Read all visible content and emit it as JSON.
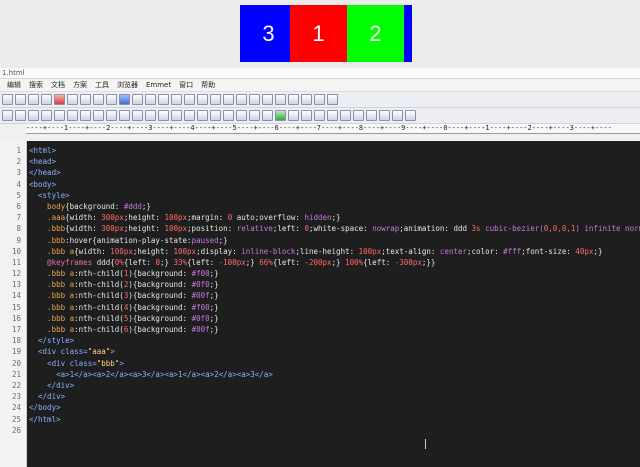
{
  "preview": {
    "slides": [
      "3",
      "1",
      "2"
    ],
    "colors": {
      "background": "#0000ff",
      "slide_red": "#ff0000",
      "slide_green": "#00ff00"
    }
  },
  "window": {
    "title": "1.html"
  },
  "menu": [
    "编辑",
    "搜索",
    "文档",
    "方案",
    "工具",
    "浏览器",
    "Emmet",
    "窗口",
    "帮助"
  ],
  "ruler": "----+----1----+----2----+----3----+----4----+----5----+----6----+----7----+----8----+----9----+----0----+----1----+----2----+----3----+----",
  "code_lines": [
    {
      "n": "1",
      "segs": [
        {
          "t": "<html>",
          "c": "tag"
        }
      ]
    },
    {
      "n": "2",
      "segs": [
        {
          "t": "<head>",
          "c": "tag"
        }
      ]
    },
    {
      "n": "3",
      "segs": [
        {
          "t": "</head>",
          "c": "tag"
        }
      ]
    },
    {
      "n": "4",
      "segs": [
        {
          "t": "<body>",
          "c": "tag"
        }
      ]
    },
    {
      "n": "5",
      "segs": [
        {
          "t": "  <style>",
          "c": "tag"
        }
      ]
    },
    {
      "n": "6",
      "segs": [
        {
          "t": "    body",
          "c": "sel"
        },
        {
          "t": "{background: ",
          "c": "prop"
        },
        {
          "t": "#ddd",
          "c": "val"
        },
        {
          "t": ";}",
          "c": "prop"
        }
      ]
    },
    {
      "n": "7",
      "segs": [
        {
          "t": "    .aaa",
          "c": "sel"
        },
        {
          "t": "{width: ",
          "c": "prop"
        },
        {
          "t": "300px",
          "c": "num"
        },
        {
          "t": ";height: ",
          "c": "prop"
        },
        {
          "t": "100px",
          "c": "num"
        },
        {
          "t": ";margin: ",
          "c": "prop"
        },
        {
          "t": "0",
          "c": "num"
        },
        {
          "t": " auto;overflow: ",
          "c": "prop"
        },
        {
          "t": "hidden",
          "c": "val"
        },
        {
          "t": ";}",
          "c": "prop"
        }
      ]
    },
    {
      "n": "8",
      "segs": [
        {
          "t": "    .bbb",
          "c": "sel"
        },
        {
          "t": "{width: ",
          "c": "prop"
        },
        {
          "t": "300px",
          "c": "num"
        },
        {
          "t": ";height: ",
          "c": "prop"
        },
        {
          "t": "100px",
          "c": "num"
        },
        {
          "t": ";position: ",
          "c": "prop"
        },
        {
          "t": "relative",
          "c": "val"
        },
        {
          "t": ";left: ",
          "c": "prop"
        },
        {
          "t": "0",
          "c": "num"
        },
        {
          "t": ";white-space: ",
          "c": "prop"
        },
        {
          "t": "nowrap",
          "c": "val"
        },
        {
          "t": ";animation: ddd ",
          "c": "prop"
        },
        {
          "t": "3s",
          "c": "num"
        },
        {
          "t": " cubic-bezier(",
          "c": "val"
        },
        {
          "t": "0,0,0,1",
          "c": "num"
        },
        {
          "t": ") infinite normal;}",
          "c": "val"
        }
      ]
    },
    {
      "n": "9",
      "segs": [
        {
          "t": "    .bbb",
          "c": "sel"
        },
        {
          "t": ":hover{animation-play-state:",
          "c": "prop"
        },
        {
          "t": "paused",
          "c": "val"
        },
        {
          "t": ";}",
          "c": "prop"
        }
      ]
    },
    {
      "n": "10",
      "segs": [
        {
          "t": "    .bbb a",
          "c": "sel"
        },
        {
          "t": "{width: ",
          "c": "prop"
        },
        {
          "t": "100px",
          "c": "num"
        },
        {
          "t": ";height: ",
          "c": "prop"
        },
        {
          "t": "100px",
          "c": "num"
        },
        {
          "t": ";display: ",
          "c": "prop"
        },
        {
          "t": "inline-block",
          "c": "val"
        },
        {
          "t": ";line-height: ",
          "c": "prop"
        },
        {
          "t": "100px",
          "c": "num"
        },
        {
          "t": ";text-align: ",
          "c": "prop"
        },
        {
          "t": "center",
          "c": "val"
        },
        {
          "t": ";color: ",
          "c": "prop"
        },
        {
          "t": "#fff",
          "c": "val"
        },
        {
          "t": ";font-size: ",
          "c": "prop"
        },
        {
          "t": "40px",
          "c": "num"
        },
        {
          "t": ";}",
          "c": "prop"
        }
      ]
    },
    {
      "n": "11",
      "segs": [
        {
          "t": "    @keyframes",
          "c": "kw"
        },
        {
          "t": " ddd{",
          "c": "prop"
        },
        {
          "t": "0%",
          "c": "num"
        },
        {
          "t": "{left: ",
          "c": "prop"
        },
        {
          "t": "0",
          "c": "num"
        },
        {
          "t": ";} ",
          "c": "prop"
        },
        {
          "t": "33%",
          "c": "num"
        },
        {
          "t": "{left: ",
          "c": "prop"
        },
        {
          "t": "-100px",
          "c": "num"
        },
        {
          "t": ";} ",
          "c": "prop"
        },
        {
          "t": "66%",
          "c": "num"
        },
        {
          "t": "{left: ",
          "c": "prop"
        },
        {
          "t": "-200px",
          "c": "num"
        },
        {
          "t": ";} ",
          "c": "prop"
        },
        {
          "t": "100%",
          "c": "num"
        },
        {
          "t": "{left: ",
          "c": "prop"
        },
        {
          "t": "-300px",
          "c": "num"
        },
        {
          "t": ";}}",
          "c": "prop"
        }
      ]
    },
    {
      "n": "12",
      "segs": [
        {
          "t": "    .bbb a",
          "c": "sel"
        },
        {
          "t": ":nth-child(",
          "c": "prop"
        },
        {
          "t": "1",
          "c": "num"
        },
        {
          "t": "){background: ",
          "c": "prop"
        },
        {
          "t": "#f00",
          "c": "val"
        },
        {
          "t": ";}",
          "c": "prop"
        }
      ]
    },
    {
      "n": "13",
      "segs": [
        {
          "t": "    .bbb a",
          "c": "sel"
        },
        {
          "t": ":nth-child(",
          "c": "prop"
        },
        {
          "t": "2",
          "c": "num"
        },
        {
          "t": "){background: ",
          "c": "prop"
        },
        {
          "t": "#0f0",
          "c": "val"
        },
        {
          "t": ";}",
          "c": "prop"
        }
      ]
    },
    {
      "n": "14",
      "segs": [
        {
          "t": "    .bbb a",
          "c": "sel"
        },
        {
          "t": ":nth-child(",
          "c": "prop"
        },
        {
          "t": "3",
          "c": "num"
        },
        {
          "t": "){background: ",
          "c": "prop"
        },
        {
          "t": "#00f",
          "c": "val"
        },
        {
          "t": ";}",
          "c": "prop"
        }
      ]
    },
    {
      "n": "15",
      "segs": [
        {
          "t": "    .bbb a",
          "c": "sel"
        },
        {
          "t": ":nth-child(",
          "c": "prop"
        },
        {
          "t": "4",
          "c": "num"
        },
        {
          "t": "){background: ",
          "c": "prop"
        },
        {
          "t": "#f00",
          "c": "val"
        },
        {
          "t": ";}",
          "c": "prop"
        }
      ]
    },
    {
      "n": "16",
      "segs": [
        {
          "t": "    .bbb a",
          "c": "sel"
        },
        {
          "t": ":nth-child(",
          "c": "prop"
        },
        {
          "t": "5",
          "c": "num"
        },
        {
          "t": "){background: ",
          "c": "prop"
        },
        {
          "t": "#0f0",
          "c": "val"
        },
        {
          "t": ";}",
          "c": "prop"
        }
      ]
    },
    {
      "n": "17",
      "segs": [
        {
          "t": "    .bbb a",
          "c": "sel"
        },
        {
          "t": ":nth-child(",
          "c": "prop"
        },
        {
          "t": "6",
          "c": "num"
        },
        {
          "t": "){background: ",
          "c": "prop"
        },
        {
          "t": "#00f",
          "c": "val"
        },
        {
          "t": ";}",
          "c": "prop"
        }
      ]
    },
    {
      "n": "18",
      "segs": [
        {
          "t": "  </style>",
          "c": "tag"
        }
      ]
    },
    {
      "n": "19",
      "segs": [
        {
          "t": "  <div class=",
          "c": "tag"
        },
        {
          "t": "\"aaa\"",
          "c": "str"
        },
        {
          "t": ">",
          "c": "tag"
        }
      ]
    },
    {
      "n": "20",
      "segs": [
        {
          "t": "    <div class=",
          "c": "tag"
        },
        {
          "t": "\"bbb\"",
          "c": "str"
        },
        {
          "t": ">",
          "c": "tag"
        }
      ]
    },
    {
      "n": "21",
      "segs": [
        {
          "t": "      <a>1</a><a>2</a><a>3</a><a>1</a><a>2</a><a>3</a>",
          "c": "tag"
        }
      ]
    },
    {
      "n": "22",
      "segs": [
        {
          "t": "    </div>",
          "c": "tag"
        }
      ]
    },
    {
      "n": "23",
      "segs": [
        {
          "t": "  </div>",
          "c": "tag"
        }
      ]
    },
    {
      "n": "24",
      "segs": [
        {
          "t": "</body>",
          "c": "tag"
        }
      ]
    },
    {
      "n": "25",
      "segs": [
        {
          "t": "</html>",
          "c": "tag"
        }
      ]
    },
    {
      "n": "26",
      "segs": []
    }
  ]
}
